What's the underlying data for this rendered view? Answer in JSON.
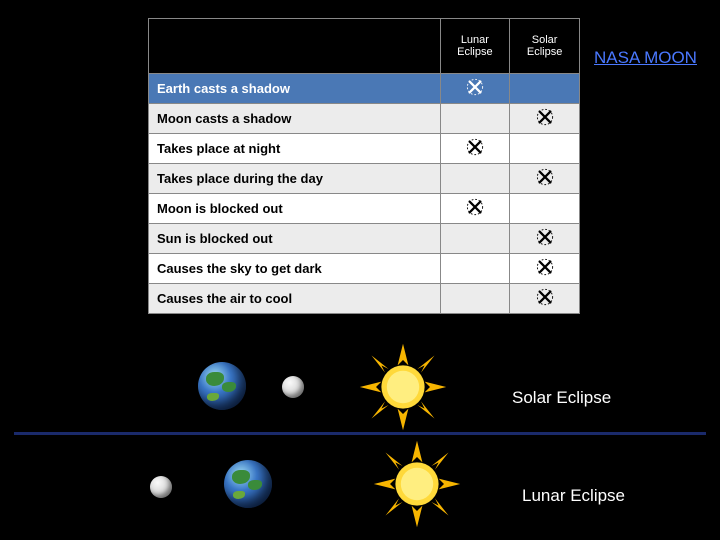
{
  "link": {
    "text": "NASA MOON"
  },
  "headers": {
    "desc": "",
    "lunar": "Lunar Eclipse",
    "solar": "Solar Eclipse"
  },
  "rows": [
    {
      "desc": "Earth casts a shadow",
      "lunar": true,
      "solar": false,
      "selected": true
    },
    {
      "desc": "Moon casts a shadow",
      "lunar": false,
      "solar": true
    },
    {
      "desc": "Takes place at night",
      "lunar": true,
      "solar": false
    },
    {
      "desc": "Takes place during the day",
      "lunar": false,
      "solar": true
    },
    {
      "desc": "Moon is blocked out",
      "lunar": true,
      "solar": false
    },
    {
      "desc": "Sun is blocked out",
      "lunar": false,
      "solar": true
    },
    {
      "desc": "Causes the sky to get dark",
      "lunar": false,
      "solar": true
    },
    {
      "desc": "Causes the air to cool",
      "lunar": false,
      "solar": true
    }
  ],
  "diagram": {
    "solar_label": "Solar Eclipse",
    "lunar_label": "Lunar Eclipse"
  },
  "chart_data": {
    "type": "table",
    "title": "Lunar vs Solar Eclipse comparison",
    "columns": [
      "",
      "Lunar Eclipse",
      "Solar Eclipse"
    ],
    "rows": [
      [
        "Earth casts a shadow",
        "x",
        ""
      ],
      [
        "Moon casts a shadow",
        "",
        "x"
      ],
      [
        "Takes place at night",
        "x",
        ""
      ],
      [
        "Takes place during the day",
        "",
        "x"
      ],
      [
        "Moon is blocked out",
        "x",
        ""
      ],
      [
        "Sun is blocked out",
        "",
        "x"
      ],
      [
        "Causes the sky to get dark",
        "",
        "x"
      ],
      [
        "Causes the air to cool",
        "",
        "x"
      ]
    ]
  }
}
